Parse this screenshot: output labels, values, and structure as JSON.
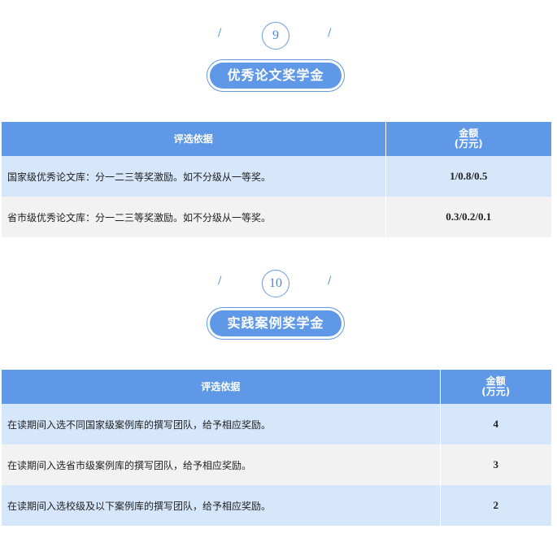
{
  "sections": [
    {
      "number": "9",
      "title": "优秀论文奖学金",
      "headers": {
        "basis": "评选依据",
        "amount_line1": "金额",
        "amount_line2": "(万元)"
      },
      "rows": [
        {
          "basis": "国家级优秀论文库：分一二三等奖激励。如不分级从一等奖。",
          "amount": "1/0.8/0.5"
        },
        {
          "basis": "省市级优秀论文库：分一二三等奖激励。如不分级从一等奖。",
          "amount": "0.3/0.2/0.1"
        }
      ]
    },
    {
      "number": "10",
      "title": "实践案例奖学金",
      "headers": {
        "basis": "评选依据",
        "amount_line1": "金额",
        "amount_line2": "(万元)"
      },
      "rows": [
        {
          "basis": "在读期间入选不同国家级案例库的撰写团队，给予相应奖励。",
          "amount": "4"
        },
        {
          "basis": "在读期间入选省市级案例库的撰写团队，给予相应奖励。",
          "amount": "3"
        },
        {
          "basis": "在读期间入选校级及以下案例库的撰写团队，给予相应奖励。",
          "amount": "2"
        }
      ]
    }
  ],
  "decor": {
    "slash": "/"
  },
  "colors": {
    "accent": "#5f98e6",
    "row_blue": "#d7e7fb",
    "row_gray": "#f2f2f2"
  }
}
